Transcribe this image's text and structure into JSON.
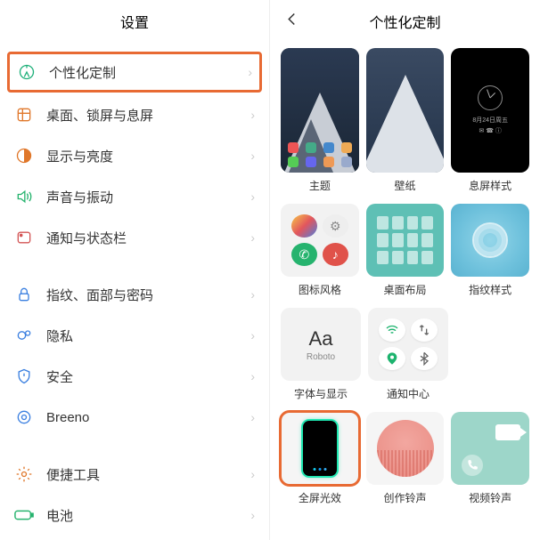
{
  "left": {
    "title": "设置",
    "items": [
      {
        "label": "个性化定制",
        "highlight": true
      },
      {
        "label": "桌面、锁屏与息屏"
      },
      {
        "label": "显示与亮度"
      },
      {
        "label": "声音与振动"
      },
      {
        "label": "通知与状态栏"
      },
      {
        "label": "指纹、面部与密码"
      },
      {
        "label": "隐私"
      },
      {
        "label": "安全"
      },
      {
        "label": "Breeno"
      },
      {
        "label": "便捷工具"
      },
      {
        "label": "电池"
      }
    ]
  },
  "right": {
    "title": "个性化定制",
    "row1": [
      {
        "label": "主题"
      },
      {
        "label": "壁纸"
      },
      {
        "label": "息屏样式"
      }
    ],
    "row2": [
      {
        "label": "图标风格"
      },
      {
        "label": "桌面布局"
      },
      {
        "label": "指纹样式"
      }
    ],
    "row3": [
      {
        "label": "字体与显示",
        "font_sample": "Aa",
        "font_name": "Roboto"
      },
      {
        "label": "通知中心"
      }
    ],
    "row4": [
      {
        "label": "全屏光效",
        "highlight": true
      },
      {
        "label": "创作铃声"
      },
      {
        "label": "视频铃声"
      }
    ],
    "aod_date": "8月24日周五"
  }
}
